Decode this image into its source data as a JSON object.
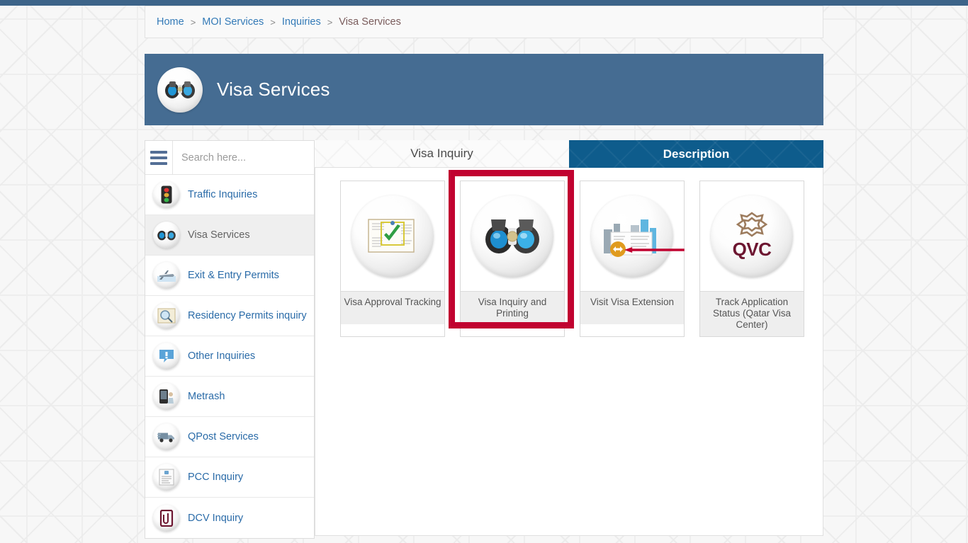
{
  "top_bar": {
    "color": "#3d6489"
  },
  "breadcrumb": {
    "items": [
      "Home",
      "MOI Services",
      "Inquiries",
      "Visa Services"
    ],
    "separator": ">"
  },
  "banner": {
    "title": "Visa Services",
    "icon": "binoculars-icon",
    "background_color": "#456c92"
  },
  "sidebar": {
    "menu_icon": "hamburger-icon",
    "search": {
      "value": "",
      "placeholder": "Search here..."
    },
    "items": [
      {
        "label": "Traffic Inquiries",
        "icon": "traffic-light-icon",
        "active": false
      },
      {
        "label": "Visa Services",
        "icon": "binoculars-icon",
        "active": true
      },
      {
        "label": "Exit & Entry Permits",
        "icon": "airplane-icon",
        "active": false
      },
      {
        "label": "Residency Permits inquiry",
        "icon": "magnifier-document-icon",
        "active": false
      },
      {
        "label": "Other Inquiries",
        "icon": "exclamation-bubble-icon",
        "active": false
      },
      {
        "label": "Metrash",
        "icon": "mobile-phone-icon",
        "active": false
      },
      {
        "label": "QPost Services",
        "icon": "delivery-van-icon",
        "active": false
      },
      {
        "label": "PCC Inquiry",
        "icon": "certificate-icon",
        "active": false
      },
      {
        "label": "DCV Inquiry",
        "icon": "document-clip-icon",
        "active": false
      }
    ]
  },
  "tabs": [
    {
      "label": "Visa Inquiry",
      "active": false
    },
    {
      "label": "Description",
      "active": true
    }
  ],
  "cards": [
    {
      "label": "Visa Approval Tracking",
      "icon": "document-checkmark-icon",
      "highlighted": false
    },
    {
      "label": "Visa Inquiry and Printing",
      "icon": "binoculars-icon",
      "highlighted": true
    },
    {
      "label": "Visit Visa Extension",
      "icon": "city-document-extend-icon",
      "highlighted": false
    },
    {
      "label": "Track Application Status (Qatar Visa Center)",
      "icon": "qvc-logo-icon",
      "highlighted": false
    }
  ],
  "annotations": {
    "highlight_box_color": "#c10230",
    "arrow_color": "#c10230",
    "arrow_direction": "left"
  }
}
